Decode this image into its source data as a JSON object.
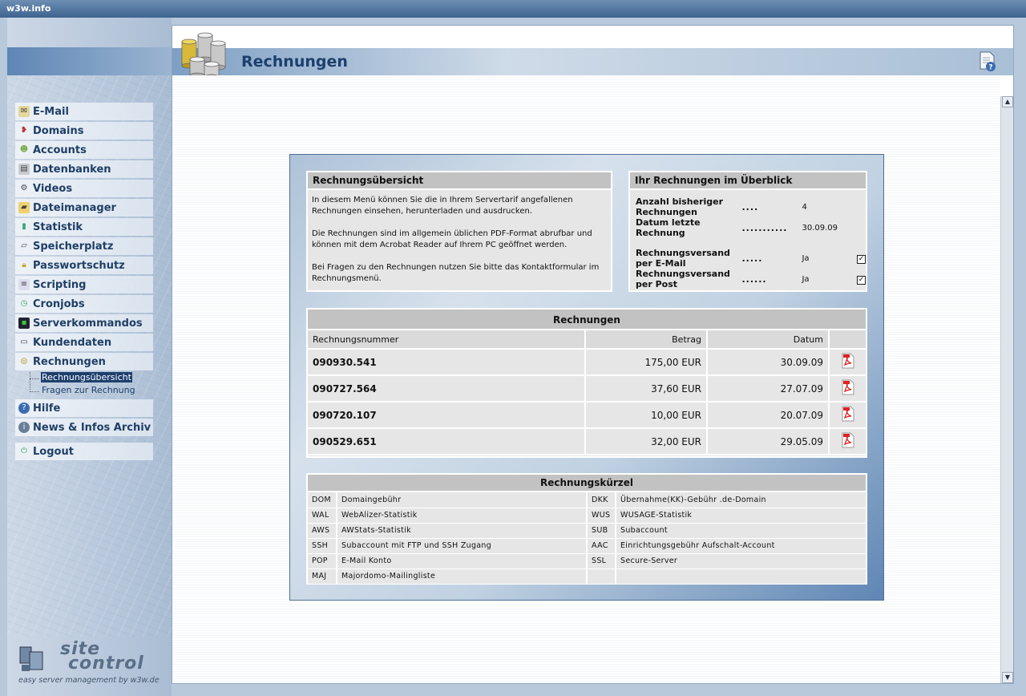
{
  "window": {
    "title": "w3w.info"
  },
  "page": {
    "title": "Rechnungen"
  },
  "nav": {
    "items": [
      {
        "label": "E-Mail",
        "icon": "mail-icon"
      },
      {
        "label": "Domains",
        "icon": "domains-icon"
      },
      {
        "label": "Accounts",
        "icon": "accounts-icon"
      },
      {
        "label": "Datenbanken",
        "icon": "database-icon"
      },
      {
        "label": "Videos",
        "icon": "video-icon"
      },
      {
        "label": "Dateimanager",
        "icon": "folder-icon"
      },
      {
        "label": "Statistik",
        "icon": "statistics-icon"
      },
      {
        "label": "Speicherplatz",
        "icon": "disk-icon"
      },
      {
        "label": "Passwortschutz",
        "icon": "lock-icon"
      },
      {
        "label": "Scripting",
        "icon": "script-icon"
      },
      {
        "label": "Cronjobs",
        "icon": "clock-icon"
      },
      {
        "label": "Serverkommandos",
        "icon": "terminal-icon"
      },
      {
        "label": "Kundendaten",
        "icon": "customer-data-icon"
      },
      {
        "label": "Rechnungen",
        "icon": "invoices-icon"
      }
    ],
    "sub_items": [
      "Rechnungsübersicht",
      "Fragen zur Rechnung"
    ],
    "items_after": [
      {
        "label": "Hilfe",
        "icon": "help-icon"
      },
      {
        "label": "News & Infos Archiv",
        "icon": "info-icon"
      }
    ],
    "logout": "Logout"
  },
  "logo": {
    "line1": "site",
    "line2": "control",
    "tagline": "easy server management by w3w.de"
  },
  "overview": {
    "title": "Rechnungsübersicht",
    "paragraphs": [
      "In diesem Menü können Sie die in Ihrem Servertarif angefallenen Rechnungen einsehen, herunterladen und ausdrucken.",
      "Die Rechnungen sind im allgemein üblichen PDF-Format abrufbar und können mit dem Acrobat Reader auf Ihrem PC geöffnet werden.",
      "Bei Fragen zu den Rechnungen nutzen Sie bitte das Kontaktformular im Rechnungsmenü."
    ]
  },
  "summary": {
    "title": "Ihr Rechnungen im Überblick",
    "count_label": "Anzahl bisheriger Rechnungen",
    "count_dots": "....",
    "count_value": "4",
    "last_label": "Datum letzte Rechnung",
    "last_dots": "...........",
    "last_value": "30.09.09",
    "email_label": "Rechnungsversand per E-Mail",
    "email_dots": ".....",
    "email_value": "Ja",
    "post_label": "Rechnungsversand per Post",
    "post_dots": "......",
    "post_value": "Ja"
  },
  "invoices": {
    "title": "Rechnungen",
    "columns": [
      "Rechnungsnummer",
      "Betrag",
      "Datum"
    ],
    "rows": [
      {
        "nr": "090930.541",
        "amount": "175,00 EUR",
        "date": "30.09.09"
      },
      {
        "nr": "090727.564",
        "amount": "37,60 EUR",
        "date": "27.07.09"
      },
      {
        "nr": "090720.107",
        "amount": "10,00 EUR",
        "date": "20.07.09"
      },
      {
        "nr": "090529.651",
        "amount": "32,00 EUR",
        "date": "29.05.09"
      }
    ]
  },
  "abbreviations": {
    "title": "Rechnungskürzel",
    "rows": [
      {
        "k1": "DOM",
        "v1": "Domaingebühr",
        "k2": "DKK",
        "v2": "Übernahme(KK)-Gebühr .de-Domain"
      },
      {
        "k1": "WAL",
        "v1": "WebAlizer-Statistik",
        "k2": "WUS",
        "v2": "WUSAGE-Statistik"
      },
      {
        "k1": "AWS",
        "v1": "AWStats-Statistik",
        "k2": "SUB",
        "v2": "Subaccount"
      },
      {
        "k1": "SSH",
        "v1": "Subaccount mit FTP und SSH Zugang",
        "k2": "AAC",
        "v2": "Einrichtungsgebühr Aufschalt-Account"
      },
      {
        "k1": "POP",
        "v1": "E-Mail Konto",
        "k2": "SSL",
        "v2": "Secure-Server"
      },
      {
        "k1": "MAJ",
        "v1": "Majordomo-Mailingliste",
        "k2": "",
        "v2": ""
      }
    ]
  }
}
